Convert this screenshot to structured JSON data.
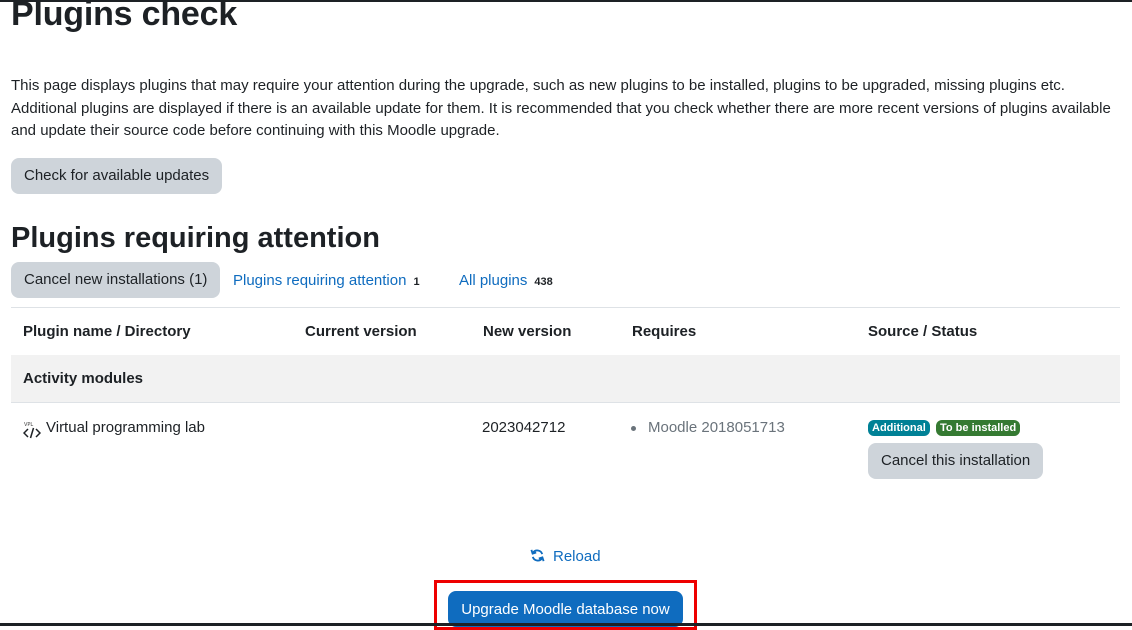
{
  "page": {
    "title": "Plugins check",
    "intro": "This page displays plugins that may require your attention during the upgrade, such as new plugins to be installed, plugins to be upgraded, missing plugins etc. Additional plugins are displayed if there is an available update for them. It is recommended that you check whether there are more recent versions of plugins available and update their source code before continuing with this Moodle upgrade.",
    "check_updates_label": "Check for available updates"
  },
  "attention": {
    "heading": "Plugins requiring attention",
    "cancel_new_label": "Cancel new installations (1)",
    "filter_attention_label": "Plugins requiring attention",
    "filter_attention_count": "1",
    "filter_all_label": "All plugins",
    "filter_all_count": "438"
  },
  "table": {
    "headers": [
      "Plugin name / Directory",
      "Current version",
      "New version",
      "Requires",
      "Source / Status"
    ],
    "group_label": "Activity modules",
    "rows": [
      {
        "icon": "vpl-code-icon",
        "name": "Virtual programming lab",
        "current_version": "",
        "new_version": "2023042712",
        "requires": [
          "Moodle 2018051713"
        ],
        "source_badge": "Additional",
        "status_badge": "To be installed",
        "action_label": "Cancel this installation"
      }
    ]
  },
  "footer": {
    "reload_label": "Reload",
    "upgrade_label": "Upgrade Moodle database now"
  },
  "colors": {
    "link": "#0f6cbf",
    "primary": "#0f6cbf",
    "secondary_button": "#ced4da",
    "badge_info": "#008196",
    "badge_success": "#357a32",
    "highlight": "#e00000"
  }
}
